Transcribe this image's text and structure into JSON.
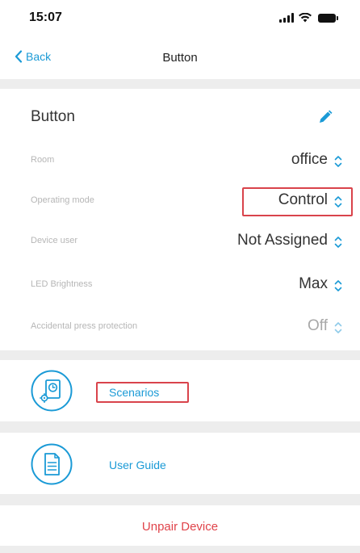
{
  "status_bar": {
    "time": "15:07",
    "icons": [
      "signal-icon",
      "wifi-icon",
      "battery-icon"
    ]
  },
  "nav": {
    "back_label": "Back",
    "title": "Button"
  },
  "device": {
    "name": "Button",
    "edit_icon": "pencil-icon"
  },
  "settings": [
    {
      "label": "Room",
      "value": "office"
    },
    {
      "label": "Operating mode",
      "value": "Control"
    },
    {
      "label": "Device user",
      "value": "Not Assigned"
    },
    {
      "label": "LED Brightness",
      "value": "Max"
    },
    {
      "label": "Accidental press protection",
      "value": "Off"
    }
  ],
  "links": [
    {
      "label": "Scenarios",
      "icon": "scenarios-icon"
    },
    {
      "label": "User Guide",
      "icon": "document-icon"
    }
  ],
  "unpair": {
    "label": "Unpair Device"
  },
  "colors": {
    "accent": "#1a9ad6",
    "danger": "#e0434a",
    "highlight": "#d9434b",
    "section_gap": "#ededed"
  }
}
